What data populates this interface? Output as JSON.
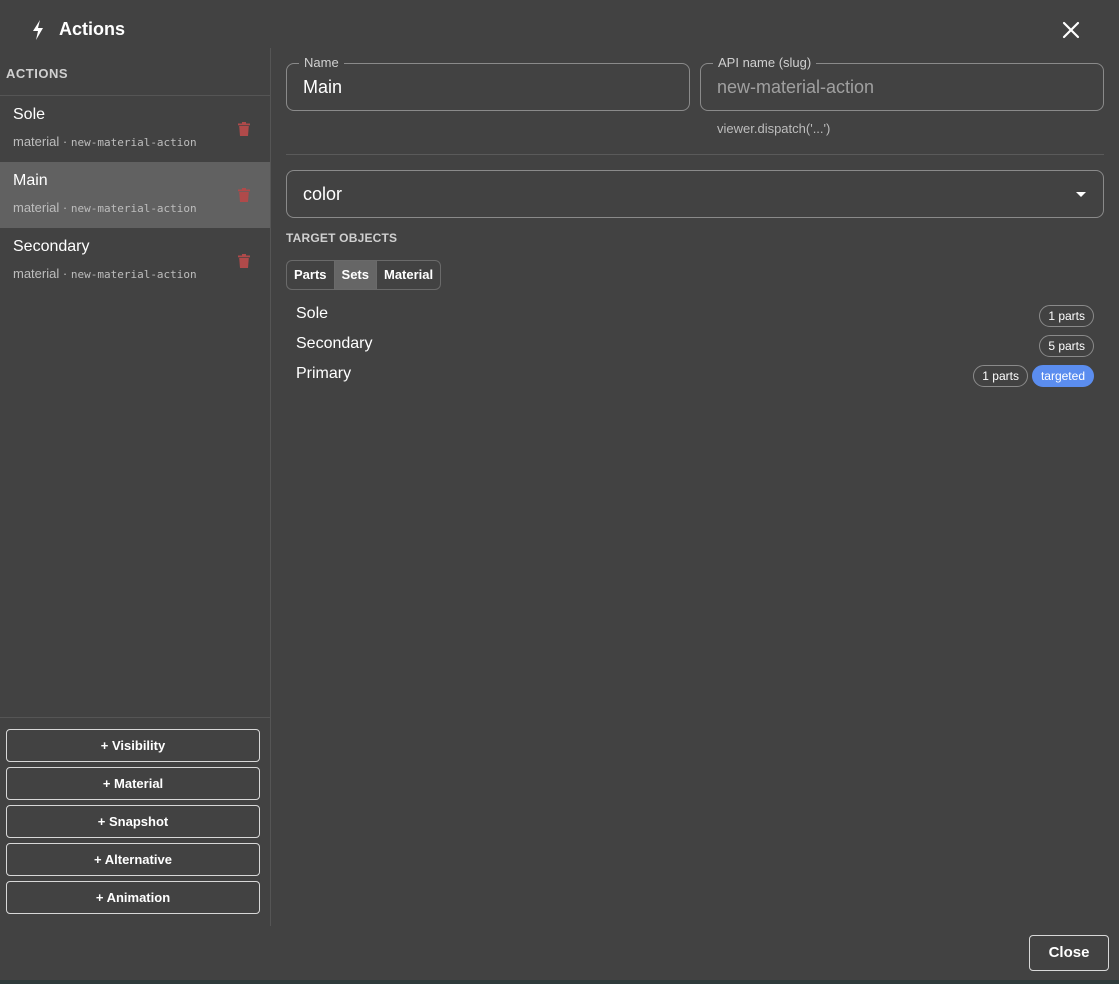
{
  "header": {
    "title": "Actions",
    "icon": "bolt-icon",
    "close_icon": "close-icon"
  },
  "sidebar": {
    "heading": "ACTIONS",
    "items": [
      {
        "name": "Sole",
        "type": "material",
        "separator": "·",
        "slug": "new-material-action",
        "selected": false
      },
      {
        "name": "Main",
        "type": "material",
        "separator": "·",
        "slug": "new-material-action",
        "selected": true
      },
      {
        "name": "Secondary",
        "type": "material",
        "separator": "·",
        "slug": "new-material-action",
        "selected": false
      }
    ],
    "add_buttons": [
      {
        "label": "+ Visibility"
      },
      {
        "label": "+ Material"
      },
      {
        "label": "+ Snapshot"
      },
      {
        "label": "+ Alternative"
      },
      {
        "label": "+ Animation"
      }
    ]
  },
  "form": {
    "name_label": "Name",
    "name_value": "Main",
    "slug_label": "API name (slug)",
    "slug_placeholder": "new-material-action",
    "slug_helper": "viewer.dispatch('...')",
    "property_value": "color"
  },
  "targets": {
    "heading": "TARGET OBJECTS",
    "tabs": [
      {
        "label": "Parts",
        "active": false
      },
      {
        "label": "Sets",
        "active": true
      },
      {
        "label": "Material",
        "active": false
      }
    ],
    "rows": [
      {
        "name": "Sole",
        "parts": "1 parts",
        "targeted": false
      },
      {
        "name": "Secondary",
        "parts": "5 parts",
        "targeted": false
      },
      {
        "name": "Primary",
        "parts": "1 parts",
        "targeted": true,
        "targeted_label": "targeted"
      }
    ]
  },
  "footer": {
    "close_label": "Close"
  },
  "colors": {
    "background": "#424242",
    "selected_item": "#616161",
    "trash": "#b04a4a",
    "targeted_pill": "#5b8def"
  }
}
